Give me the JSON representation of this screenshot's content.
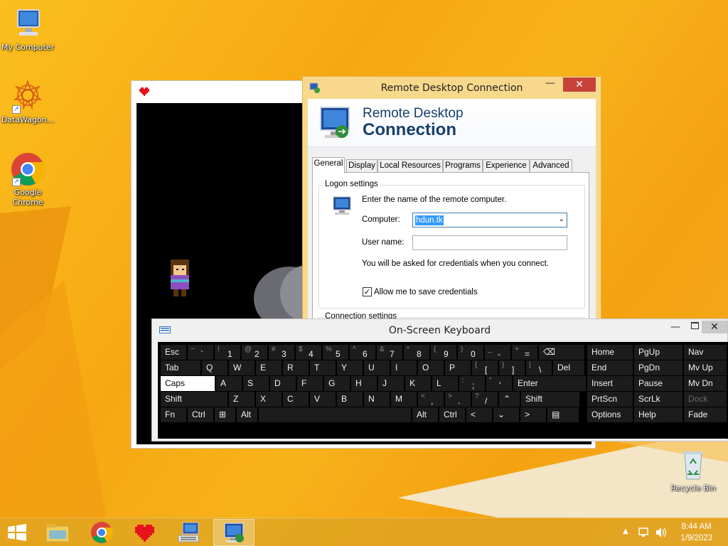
{
  "desktop": {
    "icons": [
      {
        "label": "My Computer"
      },
      {
        "label": "DataWagon..."
      },
      {
        "label": "Google Chrome"
      },
      {
        "label": "Recycle Bin"
      }
    ]
  },
  "rdc": {
    "title": "Remote Desktop Connection",
    "close_label": "✕",
    "min_label": "—",
    "banner_line1": "Remote Desktop",
    "banner_line2": "Connection",
    "tabs": [
      "General",
      "Display",
      "Local Resources",
      "Programs",
      "Experience",
      "Advanced"
    ],
    "active_tab": "General",
    "logon_label": "Logon settings",
    "instruction": "Enter the name of the remote computer.",
    "computer_label": "Computer:",
    "computer_value": "hdun.tk",
    "username_label": "User name:",
    "username_value": "",
    "credentials_note": "You will be asked for credentials when you connect.",
    "save_credentials_label": "Allow me to save credentials",
    "save_credentials_checked": true,
    "connection_label": "Connection settings"
  },
  "osk": {
    "title": "On-Screen Keyboard",
    "rows": [
      [
        {
          "w": 36,
          "a": "Esc"
        },
        {
          "w": 36,
          "s": "~",
          "a": "`"
        },
        {
          "w": 36,
          "s": "!",
          "a": "1"
        },
        {
          "w": 36,
          "s": "@",
          "a": "2"
        },
        {
          "w": 36,
          "s": "#",
          "a": "3"
        },
        {
          "w": 36,
          "s": "$",
          "a": "4"
        },
        {
          "w": 36,
          "s": "%",
          "a": "5"
        },
        {
          "w": 36,
          "s": "^",
          "a": "6"
        },
        {
          "w": 36,
          "s": "&",
          "a": "7"
        },
        {
          "w": 36,
          "s": "*",
          "a": "8"
        },
        {
          "w": 36,
          "s": "(",
          "a": "9"
        },
        {
          "w": 36,
          "s": ")",
          "a": "0"
        },
        {
          "w": 36,
          "s": "_",
          "a": "-"
        },
        {
          "w": 36,
          "s": "+",
          "a": "="
        },
        {
          "w": 64,
          "a": "⌫"
        }
      ],
      [
        {
          "w": 56,
          "a": "Tab"
        },
        {
          "w": 36,
          "a": "Q"
        },
        {
          "w": 36,
          "a": "W"
        },
        {
          "w": 36,
          "a": "E"
        },
        {
          "w": 36,
          "a": "R"
        },
        {
          "w": 36,
          "a": "T"
        },
        {
          "w": 36,
          "a": "Y"
        },
        {
          "w": 36,
          "a": "U"
        },
        {
          "w": 36,
          "a": "I"
        },
        {
          "w": 36,
          "a": "O"
        },
        {
          "w": 36,
          "a": "P"
        },
        {
          "w": 36,
          "s": "{",
          "a": "["
        },
        {
          "w": 36,
          "s": "}",
          "a": "]"
        },
        {
          "w": 36,
          "s": "|",
          "a": "\\"
        },
        {
          "w": 44,
          "a": "Del"
        }
      ],
      [
        {
          "w": 76,
          "a": "Caps",
          "caps": true
        },
        {
          "w": 36,
          "a": "A"
        },
        {
          "w": 36,
          "a": "S"
        },
        {
          "w": 36,
          "a": "D"
        },
        {
          "w": 36,
          "a": "F"
        },
        {
          "w": 36,
          "a": "G"
        },
        {
          "w": 36,
          "a": "H"
        },
        {
          "w": 36,
          "a": "J"
        },
        {
          "w": 36,
          "a": "K"
        },
        {
          "w": 36,
          "a": "L"
        },
        {
          "w": 36,
          "s": ":",
          "a": ";"
        },
        {
          "w": 36,
          "s": "\"",
          "a": "'"
        },
        {
          "w": 102,
          "a": "Enter"
        }
      ],
      [
        {
          "w": 94,
          "a": "Shift"
        },
        {
          "w": 36,
          "a": "Z"
        },
        {
          "w": 36,
          "a": "X"
        },
        {
          "w": 36,
          "a": "C"
        },
        {
          "w": 36,
          "a": "V"
        },
        {
          "w": 36,
          "a": "B"
        },
        {
          "w": 36,
          "a": "N"
        },
        {
          "w": 36,
          "a": "M"
        },
        {
          "w": 36,
          "s": "<",
          "a": ","
        },
        {
          "w": 36,
          "s": ">",
          "a": "."
        },
        {
          "w": 36,
          "s": "?",
          "a": "/"
        },
        {
          "w": 29,
          "a": "⌃"
        },
        {
          "w": 82,
          "a": "Shift"
        }
      ],
      [
        {
          "w": 36,
          "a": "Fn"
        },
        {
          "w": 36,
          "a": "Ctrl"
        },
        {
          "w": 29,
          "a": "⊞"
        },
        {
          "w": 29,
          "a": "Alt"
        },
        {
          "w": 214,
          "a": ""
        },
        {
          "w": 36,
          "a": "Alt"
        },
        {
          "w": 36,
          "a": "Ctrl"
        },
        {
          "w": 36,
          "a": "<"
        },
        {
          "w": 36,
          "a": "⌄"
        },
        {
          "w": 36,
          "a": ">"
        },
        {
          "w": 44,
          "a": "▤"
        }
      ]
    ],
    "nav_rows": [
      [
        "Home",
        "PgUp",
        "Nav"
      ],
      [
        "End",
        "PgDn",
        "Mv Up"
      ],
      [
        "Insert",
        "Pause",
        "Mv Dn"
      ],
      [
        "PrtScn",
        "ScrLk",
        "Dock"
      ],
      [
        "Options",
        "Help",
        "Fade"
      ]
    ]
  },
  "taskbar": {
    "time": "8:44 AM",
    "date": "1/9/2023"
  },
  "colors": {
    "accent": "#3399ff",
    "close": "#c7433a"
  }
}
